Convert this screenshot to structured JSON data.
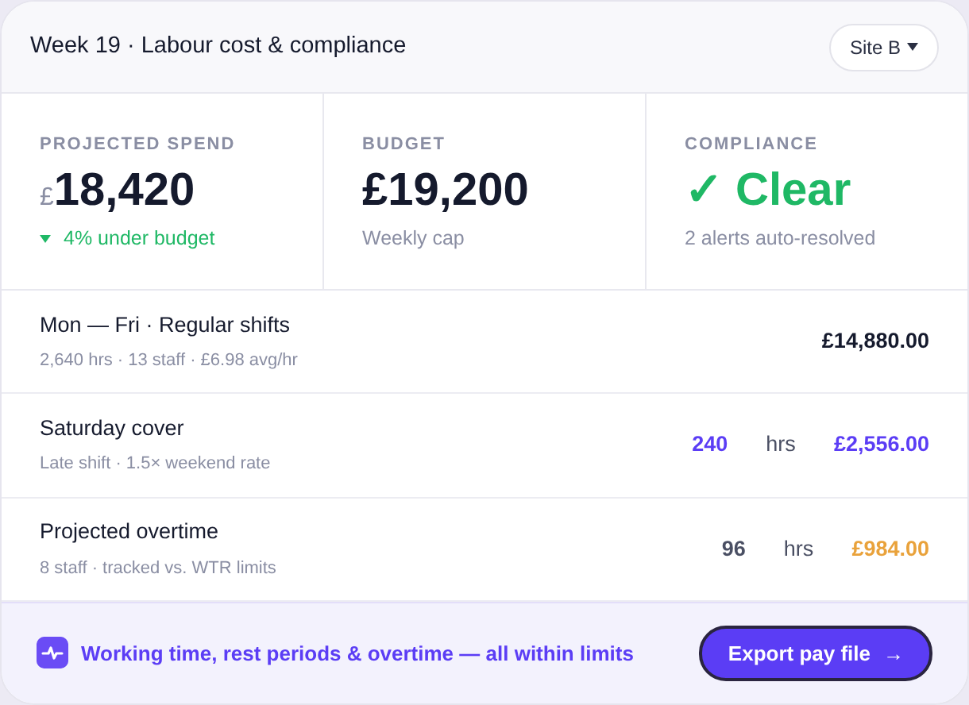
{
  "header": {
    "title": "Week 19 · Labour cost & compliance",
    "site": "Site B"
  },
  "stats": [
    {
      "kind": "spend",
      "label": "PROJECTED SPEND",
      "currency": "£",
      "value": "18,420",
      "note": "4% under budget",
      "falling": true
    },
    {
      "kind": "plain",
      "label": "BUDGET",
      "value": "£19,200",
      "note": "Weekly cap"
    },
    {
      "kind": "status",
      "label": "COMPLIANCE",
      "mark": "✓",
      "value": "Clear",
      "note": "2 alerts auto-resolved"
    }
  ],
  "rows": [
    {
      "title": "Mon — Fri · Regular shifts",
      "detail": "2,640 hrs · 13 staff · £6.98 avg/hr",
      "amount": "£14,880.00",
      "color": "#151a2d"
    },
    {
      "title": "Saturday cover",
      "detail": "Late shift · 1.5× weekend rate",
      "hours": {
        "value": "240",
        "unit": "hrs",
        "color": "#5b3df5"
      },
      "amount": "£2,556.00",
      "color": "#5b3df5"
    },
    {
      "title": "Projected overtime",
      "detail": "8 staff · tracked vs. WTR limits",
      "hours": {
        "value": "96",
        "unit": "hrs",
        "color": "#4a4f63"
      },
      "amount": "£984.00",
      "color": "#e9a23b"
    }
  ],
  "footer": {
    "message": "Working time, rest periods & overtime — all within limits",
    "button": "Export pay file",
    "button_icon": "→"
  }
}
